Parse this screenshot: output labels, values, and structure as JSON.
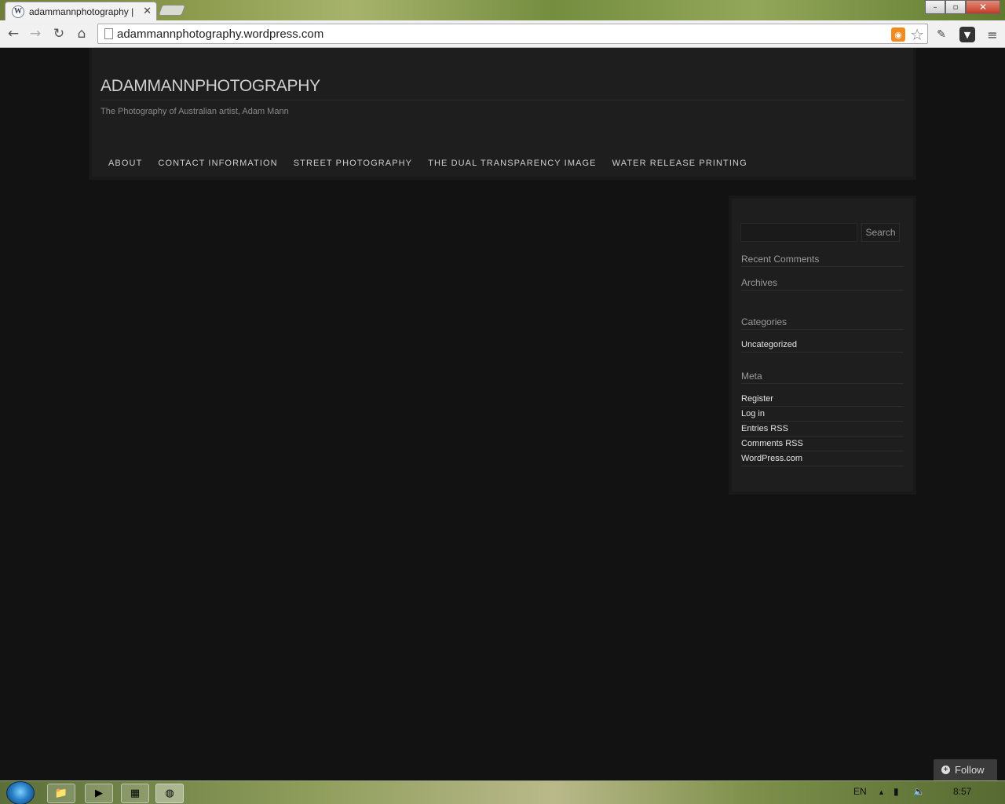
{
  "browser": {
    "tab_title": "adammannphotography |",
    "tab_close": "✕",
    "url": "adammannphotography.wordpress.com",
    "window_buttons": {
      "minimize": "–",
      "maximize": "▫",
      "close": "✕"
    }
  },
  "site": {
    "title": "ADAMMANNPHOTOGRAPHY",
    "tagline": "The Photography of Australian artist, Adam Mann",
    "nav": [
      "ABOUT",
      "CONTACT INFORMATION",
      "STREET PHOTOGRAPHY",
      "THE DUAL TRANSPARENCY IMAGE",
      "WATER RELEASE PRINTING"
    ]
  },
  "sidebar": {
    "search_button": "Search",
    "search_placeholder": "",
    "recent_comments": "Recent Comments",
    "archives": "Archives",
    "categories": "Categories",
    "category_links": [
      "Uncategorized"
    ],
    "meta": "Meta",
    "meta_links": [
      "Register",
      "Log in",
      "Entries RSS",
      "Comments RSS",
      "WordPress.com"
    ]
  },
  "follow": {
    "label": "Follow"
  },
  "taskbar": {
    "language": "EN",
    "time": "8:57"
  },
  "icons": {
    "back": "back-icon",
    "forward": "forward-icon",
    "reload": "reload-icon",
    "home": "home-icon",
    "rss": "rss-icon",
    "star": "star-icon",
    "evernote": "evernote-icon",
    "pocket": "pocket-icon",
    "menu": "menu-icon"
  }
}
